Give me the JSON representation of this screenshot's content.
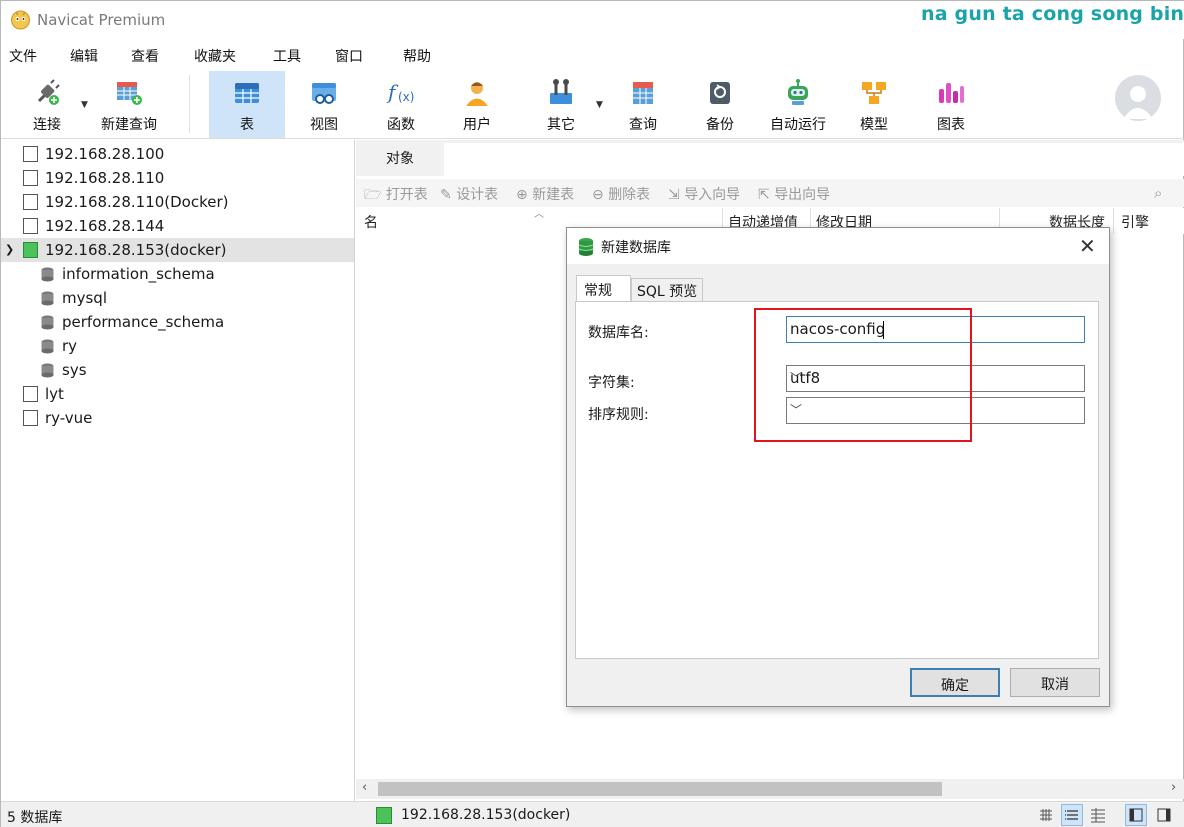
{
  "window": {
    "title": "Navicat Premium"
  },
  "overlay": {
    "text": "na gun ta cong song bin fa"
  },
  "menu": [
    "文件",
    "编辑",
    "查看",
    "收藏夹",
    "工具",
    "窗口",
    "帮助"
  ],
  "toolbar": {
    "connect": "连接",
    "new_query": "新建查询",
    "table": "表",
    "view": "视图",
    "function": "函数",
    "user": "用户",
    "other": "其它",
    "query": "查询",
    "backup": "备份",
    "auto_run": "自动运行",
    "model": "模型",
    "chart": "图表"
  },
  "tree": {
    "connections": [
      "192.168.28.100",
      "192.168.28.110",
      "192.168.28.110(Docker)",
      "192.168.28.144",
      "192.168.28.153(docker)"
    ],
    "databases": [
      "information_schema",
      "mysql",
      "performance_schema",
      "ry",
      "sys"
    ],
    "more_connections": [
      "lyt",
      "ry-vue"
    ]
  },
  "main": {
    "tab_objects": "对象",
    "object_toolbar": {
      "open_table": "打开表",
      "design_table": "设计表",
      "new_table": "新建表",
      "delete_table": "删除表",
      "import_wizard": "导入向导",
      "export_wizard": "导出向导"
    },
    "columns": {
      "name": "名",
      "auto_increment": "自动递增值",
      "modified": "修改日期",
      "data_length": "数据长度",
      "engine": "引擎"
    }
  },
  "status": {
    "db_count": "5 数据库",
    "connection": "192.168.28.153(docker)"
  },
  "dialog": {
    "title": "新建数据库",
    "tab_general": "常规",
    "tab_sql_preview": "SQL 预览",
    "db_name_label": "数据库名:",
    "db_name_value": "nacos-config",
    "charset_label": "字符集:",
    "charset_value": "utf8",
    "collation_label": "排序规则:",
    "collation_value": "",
    "ok_label": "确定",
    "cancel_label": "取消"
  },
  "colors": {
    "accent": "#cfe4f8",
    "highlight_box": "#e0151f",
    "overlay_text": "#1aa3a8",
    "connection_active": "#49c35a"
  }
}
